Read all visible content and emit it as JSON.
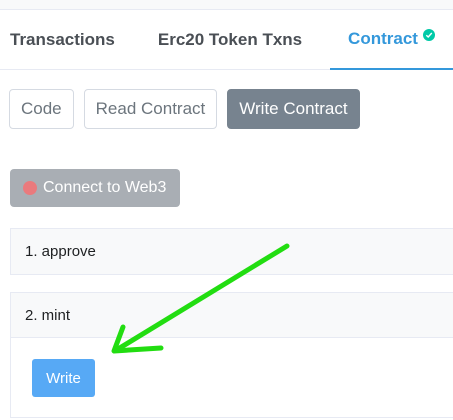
{
  "tabs": [
    {
      "label": "Transactions"
    },
    {
      "label": "Erc20 Token Txns"
    },
    {
      "label": "Contract",
      "active": true,
      "badge": "check-circle-icon"
    }
  ],
  "subnav": [
    {
      "label": "Code"
    },
    {
      "label": "Read Contract"
    },
    {
      "label": "Write Contract",
      "active": true
    }
  ],
  "connect": {
    "label": "Connect to Web3",
    "status_color": "#ea7a7d"
  },
  "functions": [
    {
      "label": "1. approve"
    },
    {
      "label": "2. mint",
      "action_label": "Write"
    }
  ],
  "colors": {
    "accent": "#3498db",
    "success": "#00c9a7",
    "annotation_arrow": "#22dd11",
    "write_button": "#57a9f5"
  }
}
